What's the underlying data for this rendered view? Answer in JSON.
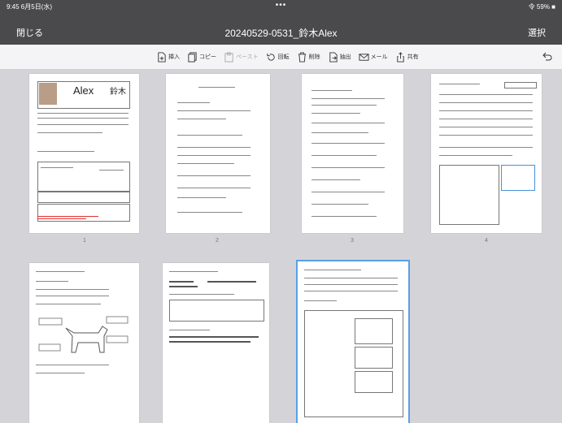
{
  "status_bar": {
    "left": "9:45 6月5日(水)",
    "right": "令 59% ■",
    "dots": "•••"
  },
  "nav": {
    "close": "閉じる",
    "title": "20240529-0531_鈴木Alex",
    "select": "選択"
  },
  "toolbar": {
    "items": [
      {
        "label": "挿入",
        "icon": "insert-page-icon",
        "enabled": true
      },
      {
        "label": "コピー",
        "icon": "copy-icon",
        "enabled": true
      },
      {
        "label": "ペースト",
        "icon": "paste-icon",
        "enabled": false
      },
      {
        "label": "回転",
        "icon": "rotate-icon",
        "enabled": true
      },
      {
        "label": "削除",
        "icon": "trash-icon",
        "enabled": true
      },
      {
        "label": "抽出",
        "icon": "extract-icon",
        "enabled": true
      },
      {
        "label": "メール",
        "icon": "mail-icon",
        "enabled": true
      },
      {
        "label": "共有",
        "icon": "share-icon",
        "enabled": true
      }
    ],
    "undo_icon": "undo-icon"
  },
  "page1": {
    "name": "Alex",
    "surname": "鈴木"
  },
  "pages": [
    {
      "number": "1"
    },
    {
      "number": "2"
    },
    {
      "number": "3"
    },
    {
      "number": "4"
    },
    {
      "number": ""
    },
    {
      "number": ""
    },
    {
      "number": "",
      "selected": true
    }
  ],
  "colors": {
    "topbar": "#4a4a4c",
    "toolbar": "#f4f4f6",
    "background": "#d4d4d8",
    "selection": "#5aa0e6"
  }
}
